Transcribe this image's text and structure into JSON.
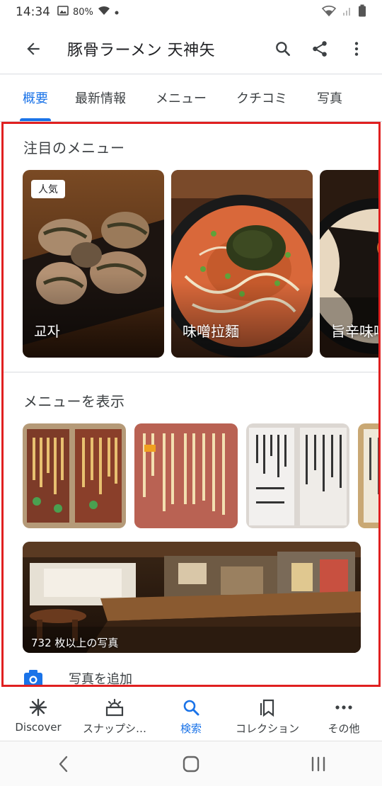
{
  "status": {
    "time": "14:34",
    "battery": "80%"
  },
  "appbar": {
    "title": "豚骨ラーメン 天神矢"
  },
  "tabs": [
    {
      "label": "概要"
    },
    {
      "label": "最新情報"
    },
    {
      "label": "メニュー"
    },
    {
      "label": "クチコミ"
    },
    {
      "label": "写真"
    }
  ],
  "featured": {
    "title": "注目のメニュー",
    "items": [
      {
        "label": "교자",
        "badge": "人気"
      },
      {
        "label": "味噌拉麵"
      },
      {
        "label": "旨辛味噌"
      }
    ]
  },
  "menu_section": {
    "title": "メニューを表示"
  },
  "photos": {
    "caption": "732 枚以上の写真"
  },
  "add_photo": {
    "label": "写真を追加"
  },
  "bottom_nav": [
    {
      "label": "Discover",
      "icon": "asterisk-icon"
    },
    {
      "label": "スナップシ…",
      "icon": "snapshot-icon"
    },
    {
      "label": "検索",
      "icon": "search-icon"
    },
    {
      "label": "コレクション",
      "icon": "collections-icon"
    },
    {
      "label": "その他",
      "icon": "more-icon"
    }
  ],
  "colors": {
    "accent": "#1a73e8",
    "highlight_border": "#e02020"
  }
}
